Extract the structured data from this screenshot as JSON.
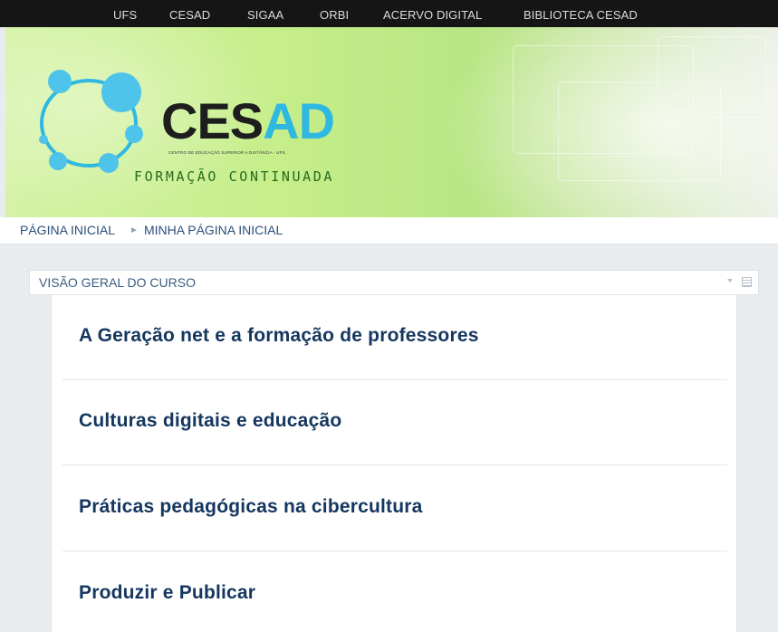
{
  "topnav": {
    "items": [
      "UFS",
      "CESAD",
      "SIGAA",
      "ORBI",
      "ACERVO DIGITAL",
      "BIBLIOTECA CESAD"
    ]
  },
  "banner": {
    "logo_main": "CES",
    "logo_accent": "AD",
    "logo_subtitle": "CENTRO DE EDUCAÇÃO SUPERIOR A DISTÂNCIA - UFS",
    "tagline": "FORMAÇÃO CONTINUADA"
  },
  "breadcrumb": {
    "home": "PÁGINA INICIAL",
    "separator": "►",
    "current": "MINHA PÁGINA INICIAL"
  },
  "block": {
    "title": "VISÃO GERAL DO CURSO",
    "courses": [
      "A Geração net e a formação de professores",
      "Culturas digitais e educação",
      "Práticas pedagógicas na cibercultura",
      "Produzir e Publicar"
    ]
  },
  "colors": {
    "topnav_bg": "#151515",
    "banner_green": "#c6ee8a",
    "logo_blue": "#2fb9e0",
    "link_blue": "#14365f"
  },
  "icons": [
    "logo-molecule-icon",
    "chevron-down-icon",
    "dock-icon"
  ]
}
